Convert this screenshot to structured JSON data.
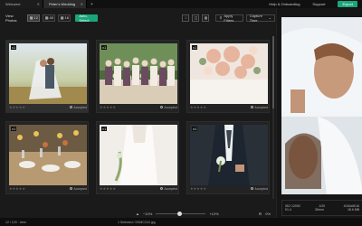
{
  "tabs": [
    {
      "label": "Welcome"
    },
    {
      "label": "Peter's Wedding"
    }
  ],
  "top_links": {
    "help": "Help & Onboarding",
    "support": "Support",
    "export": "Export"
  },
  "toolbar": {
    "view_label": "View Photos",
    "seg1": "12",
    "seg2": "40",
    "seg3": "16",
    "auto_select": "Auto-Select",
    "apply_filters": "Apply Filters",
    "sort": "Capture Time"
  },
  "photos": [
    {
      "badge": "v1",
      "status": "Accepted",
      "selected": true
    },
    {
      "badge": "v1",
      "status": "Accepted",
      "selected": false
    },
    {
      "badge": "v1",
      "status": "Accepted",
      "selected": false
    },
    {
      "badge": "v1",
      "status": "Accepted",
      "selected": false
    },
    {
      "badge": "v1",
      "status": "Accepted",
      "selected": false
    },
    {
      "badge": "v1",
      "status": "Accepted",
      "selected": false
    }
  ],
  "zoom": {
    "min": "−10%",
    "max": "+10%",
    "max_right": "0%"
  },
  "meta": {
    "iso": "ISO 12000",
    "shutter": "1/20",
    "res": "4016x6016",
    "aperture": "f/1.4",
    "focal": "35mm",
    "size": "18.6 MB"
  },
  "status_bar": {
    "left": "12 / 120 · view",
    "center": "1 Selected / DSMC2LK.jpg"
  }
}
